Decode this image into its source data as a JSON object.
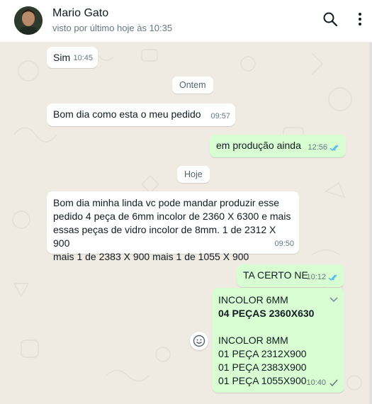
{
  "header": {
    "contact_name": "Mario Gato",
    "last_seen": "visto por último hoje às 10:35"
  },
  "chips": {
    "ontem": "Ontem",
    "hoje": "Hoje"
  },
  "messages": [
    {
      "text": "Sim",
      "time": "10:45",
      "direction": "incoming"
    },
    {
      "text": "Bom dia  como esta o meu pedido",
      "time": "09:57",
      "direction": "incoming"
    },
    {
      "text": "em produção ainda",
      "time": "12:56",
      "direction": "outgoing",
      "status": "read"
    },
    {
      "text": "Bom dia minha linda vc pode mandar produzir esse\npedido 4 peça de 6mm incolor  de 2360 X 6300 e mais\nessas peças de vidro incolor de 8mm. 1 de 2312 X 900\nmais 1 de 2383 X 900 mais 1 de 1055 X 900",
      "time": "09:50",
      "direction": "incoming"
    },
    {
      "text": "TA CERTO NE",
      "time": "10:12",
      "direction": "outgoing",
      "status": "read"
    },
    {
      "line1": "INCOLOR 6MM",
      "line2": "04 PEÇAS 2360X630",
      "line3": "INCOLOR 8MM",
      "line4": "01 PEÇA 2312X900",
      "line5": "01 PEÇA 2383X900",
      "line6": "01 PEÇA 1055X900",
      "time": "10:40",
      "direction": "outgoing",
      "status": "delivered"
    }
  ],
  "colors": {
    "chat_bg": "#efeae2",
    "incoming": "#ffffff",
    "outgoing": "#d9fdd3",
    "read_tick": "#53bdeb",
    "delivered_tick": "#667781"
  },
  "icons": {
    "search": "search-icon",
    "menu": "menu-icon",
    "emoji": "emoji-icon",
    "dropdown": "chevron-down-icon"
  }
}
